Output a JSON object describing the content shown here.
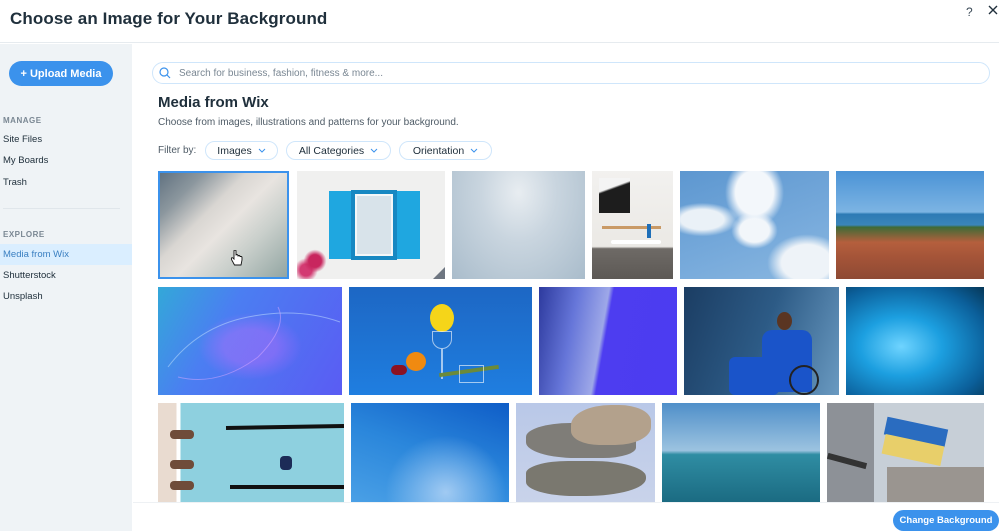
{
  "header": {
    "title": "Choose an Image for Your Background",
    "help_label": "?",
    "close_icon": "close-icon"
  },
  "sidebar": {
    "upload_label": "+ Upload Media",
    "manage_title": "MANAGE",
    "manage_items": [
      {
        "label": "Site Files"
      },
      {
        "label": "My Boards"
      },
      {
        "label": "Trash"
      }
    ],
    "explore_title": "EXPLORE",
    "explore_items": [
      {
        "label": "Media from Wix",
        "active": true
      },
      {
        "label": "Shutterstock",
        "active": false
      },
      {
        "label": "Unsplash",
        "active": false
      }
    ]
  },
  "search": {
    "placeholder": "Search for business, fashion, fitness & more...",
    "value": "",
    "icon": "search-icon"
  },
  "main": {
    "title": "Media from Wix",
    "subtitle": "Choose from images, illustrations and patterns for your background.",
    "filter_label": "Filter by:",
    "filters": [
      {
        "label": "Images"
      },
      {
        "label": "All Categories"
      },
      {
        "label": "Orientation"
      }
    ]
  },
  "images": [
    {
      "name": "blurred-light-abstract",
      "selected": true
    },
    {
      "name": "blue-shutter-window"
    },
    {
      "name": "white-crystals"
    },
    {
      "name": "minimal-interior"
    },
    {
      "name": "sky-clouds"
    },
    {
      "name": "coastal-town-rooftops"
    },
    {
      "name": "purple-wave-abstract"
    },
    {
      "name": "lemon-glass-still-life"
    },
    {
      "name": "blue-fabric-curve"
    },
    {
      "name": "man-in-wheelchair"
    },
    {
      "name": "blue-water-ripples"
    },
    {
      "name": "swimming-pool-kids"
    },
    {
      "name": "blue-sky-wisps"
    },
    {
      "name": "rock-reflection"
    },
    {
      "name": "calm-sea-horizon"
    },
    {
      "name": "ukraine-flag"
    }
  ],
  "footer": {
    "change_label": "Change Background"
  },
  "colors": {
    "accent": "#3b92ec",
    "sidebar_bg": "#eff3f6",
    "active_item_bg": "#daeeff",
    "text": "#20303c"
  }
}
